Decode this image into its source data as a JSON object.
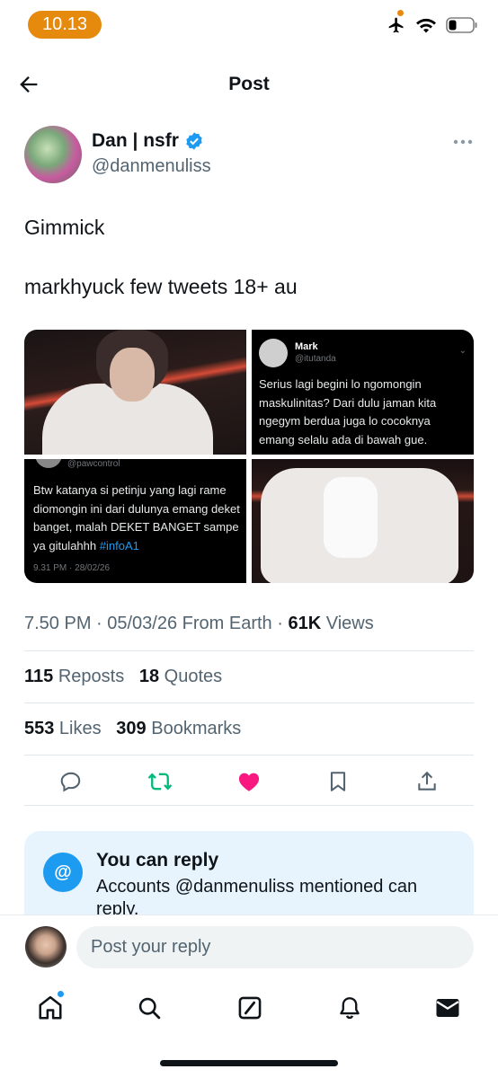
{
  "status_bar": {
    "time": "10.13",
    "accent_color": "#e68a0e",
    "icons": [
      "airplane-icon",
      "wifi-icon",
      "battery-icon"
    ]
  },
  "header": {
    "title": "Post",
    "back_icon": "arrow-left-icon"
  },
  "author": {
    "name": "Dan | nsfr",
    "handle": "@danmenuliss",
    "verified": true
  },
  "tweet": {
    "line1": "Gimmick",
    "line2": "markhyuck few tweets 18+ au"
  },
  "media": {
    "embed1": {
      "name": "Mark",
      "handle": "@itutanda",
      "text": "Serius lagi begini lo ngomongin maskulinitas? Dari dulu jaman kita ngegym berdua juga lo cocoknya emang selalu ada di bawah gue."
    },
    "embed2": {
      "handle": "@pawcontrol",
      "text": "Btw katanya si petinju yang lagi rame diomongin ini dari dulunya emang deket banget, malah DEKET BANGET sampe ya gitulahhh",
      "hashtag": "#infoA1",
      "date": "9.31 PM · 28/02/26"
    }
  },
  "meta": {
    "time_date": "7.50 PM · 05/03/26 From Earth · ",
    "views_count": "61K",
    "views_label": " Views"
  },
  "stats": {
    "reposts_count": "115",
    "reposts_label": " Reposts",
    "quotes_count": "18",
    "quotes_label": " Quotes",
    "likes_count": "553",
    "likes_label": " Likes",
    "bookmarks_count": "309",
    "bookmarks_label": " Bookmarks"
  },
  "actions": [
    "reply-icon",
    "repost-icon",
    "like-icon",
    "bookmark-icon",
    "share-icon"
  ],
  "colors": {
    "repost": "#00ba7c",
    "like": "#f91880",
    "link": "#1d9bf0"
  },
  "reply_card": {
    "icon": "@",
    "title": "You can reply",
    "description": "Accounts @danmenuliss mentioned can reply."
  },
  "composer": {
    "placeholder": "Post your reply"
  },
  "tabs": [
    "home-icon",
    "search-icon",
    "grok-icon",
    "notifications-icon",
    "messages-icon"
  ]
}
